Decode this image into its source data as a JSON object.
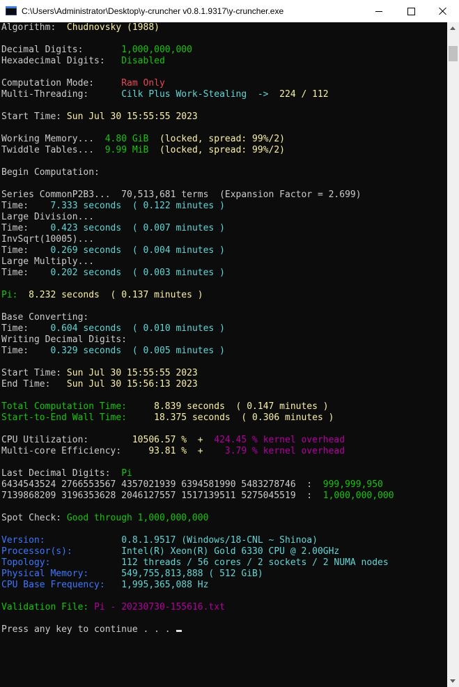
{
  "window": {
    "title": "C:\\Users\\Administrator\\Desktop\\y-cruncher v0.8.1.9317\\y-cruncher.exe"
  },
  "colors": {
    "background": "#0c0c0c",
    "white": "#cccccc",
    "yellow": "#f9f1a5",
    "green": "#16c60c",
    "red": "#e74856",
    "cyan": "#61d6d6",
    "blue": "#3b78ff",
    "magenta": "#b4009e"
  },
  "icons": [
    "console-app-icon",
    "minimize-icon",
    "maximize-icon",
    "close-icon",
    "scroll-up-arrow-icon",
    "scroll-down-arrow-icon"
  ],
  "console": {
    "lines": [
      [
        {
          "t": "Algorithm:  ",
          "c": "w"
        },
        {
          "t": "Chudnovsky (1988)",
          "c": "y"
        }
      ],
      [],
      [
        {
          "t": "Decimal Digits:       ",
          "c": "w"
        },
        {
          "t": "1,000,000,000",
          "c": "g"
        }
      ],
      [
        {
          "t": "Hexadecimal Digits:   ",
          "c": "w"
        },
        {
          "t": "Disabled",
          "c": "g"
        }
      ],
      [],
      [
        {
          "t": "Computation Mode:     ",
          "c": "w"
        },
        {
          "t": "Ram Only",
          "c": "r"
        }
      ],
      [
        {
          "t": "Multi-Threading:      ",
          "c": "w"
        },
        {
          "t": "Cilk Plus Work-Stealing  ->  ",
          "c": "c"
        },
        {
          "t": "224 / 112",
          "c": "y"
        }
      ],
      [],
      [
        {
          "t": "Start Time: ",
          "c": "w"
        },
        {
          "t": "Sun Jul 30 15:55:55 2023",
          "c": "y"
        }
      ],
      [],
      [
        {
          "t": "Working Memory...  ",
          "c": "w"
        },
        {
          "t": "4.80 GiB",
          "c": "g"
        },
        {
          "t": "  (locked, spread: 99%/2)",
          "c": "y"
        }
      ],
      [
        {
          "t": "Twiddle Tables...  ",
          "c": "w"
        },
        {
          "t": "9.99 MiB",
          "c": "g"
        },
        {
          "t": "  (locked, spread: 99%/2)",
          "c": "y"
        }
      ],
      [],
      [
        {
          "t": "Begin Computation:",
          "c": "w"
        }
      ],
      [],
      [
        {
          "t": "Series CommonP2B3...  70,513,681 terms  (Expansion Factor = 2.699)",
          "c": "w"
        }
      ],
      [
        {
          "t": "Time:    ",
          "c": "w"
        },
        {
          "t": "7.333 seconds  ( 0.122 minutes )",
          "c": "c"
        }
      ],
      [
        {
          "t": "Large Division...",
          "c": "w"
        }
      ],
      [
        {
          "t": "Time:    ",
          "c": "w"
        },
        {
          "t": "0.423 seconds  ( 0.007 minutes )",
          "c": "c"
        }
      ],
      [
        {
          "t": "InvSqrt(10005)...",
          "c": "w"
        }
      ],
      [
        {
          "t": "Time:    ",
          "c": "w"
        },
        {
          "t": "0.269 seconds  ( 0.004 minutes )",
          "c": "c"
        }
      ],
      [
        {
          "t": "Large Multiply...",
          "c": "w"
        }
      ],
      [
        {
          "t": "Time:    ",
          "c": "w"
        },
        {
          "t": "0.202 seconds  ( 0.003 minutes )",
          "c": "c"
        }
      ],
      [],
      [
        {
          "t": "Pi:  ",
          "c": "g"
        },
        {
          "t": "8.232 seconds  ( 0.137 minutes )",
          "c": "y"
        }
      ],
      [],
      [
        {
          "t": "Base Converting:",
          "c": "w"
        }
      ],
      [
        {
          "t": "Time:    ",
          "c": "w"
        },
        {
          "t": "0.604 seconds  ( 0.010 minutes )",
          "c": "c"
        }
      ],
      [
        {
          "t": "Writing Decimal Digits:",
          "c": "w"
        }
      ],
      [
        {
          "t": "Time:    ",
          "c": "w"
        },
        {
          "t": "0.329 seconds  ( 0.005 minutes )",
          "c": "c"
        }
      ],
      [],
      [
        {
          "t": "Start Time: ",
          "c": "w"
        },
        {
          "t": "Sun Jul 30 15:55:55 2023",
          "c": "y"
        }
      ],
      [
        {
          "t": "End Time:   ",
          "c": "w"
        },
        {
          "t": "Sun Jul 30 15:56:13 2023",
          "c": "y"
        }
      ],
      [],
      [
        {
          "t": "Total Computation Time:     ",
          "c": "g"
        },
        {
          "t": "8.839 seconds  ( 0.147 minutes )",
          "c": "y"
        }
      ],
      [
        {
          "t": "Start-to-End Wall Time:     ",
          "c": "g"
        },
        {
          "t": "18.375 seconds  ( 0.306 minutes )",
          "c": "y"
        }
      ],
      [],
      [
        {
          "t": "CPU Utilization:        ",
          "c": "w"
        },
        {
          "t": "10506.57 %  +  ",
          "c": "y"
        },
        {
          "t": "424.45 % kernel overhead",
          "c": "m"
        }
      ],
      [
        {
          "t": "Multi-core Efficiency:     ",
          "c": "w"
        },
        {
          "t": "93.81 %  +    ",
          "c": "y"
        },
        {
          "t": "3.79 % kernel overhead",
          "c": "m"
        }
      ],
      [],
      [
        {
          "t": "Last Decimal Digits:  ",
          "c": "w"
        },
        {
          "t": "Pi",
          "c": "g"
        }
      ],
      [
        {
          "t": "6434543524 2766553567 4357021939 6394581990 5483278746  :  ",
          "c": "w"
        },
        {
          "t": "999,999,950",
          "c": "g"
        }
      ],
      [
        {
          "t": "7139868209 3196353628 2046127557 1517139511 5275045519  :  ",
          "c": "w"
        },
        {
          "t": "1,000,000,000",
          "c": "g"
        }
      ],
      [],
      [
        {
          "t": "Spot Check: ",
          "c": "w"
        },
        {
          "t": "Good through 1,000,000,000",
          "c": "g"
        }
      ],
      [],
      [
        {
          "t": "Version:              ",
          "c": "b"
        },
        {
          "t": "0.8.1.9517 (Windows/18-CNL ~ Shinoa)",
          "c": "c"
        }
      ],
      [
        {
          "t": "Processor(s):         ",
          "c": "b"
        },
        {
          "t": "Intel(R) Xeon(R) Gold 6330 CPU @ 2.00GHz",
          "c": "c"
        }
      ],
      [
        {
          "t": "Topology:             ",
          "c": "b"
        },
        {
          "t": "112 threads / 56 cores / 2 sockets / 2 NUMA nodes",
          "c": "c"
        }
      ],
      [
        {
          "t": "Physical Memory:      ",
          "c": "b"
        },
        {
          "t": "549,755,813,888 ( 512 GiB)",
          "c": "c"
        }
      ],
      [
        {
          "t": "CPU Base Frequency:   ",
          "c": "b"
        },
        {
          "t": "1,995,365,088 Hz",
          "c": "c"
        }
      ],
      [],
      [
        {
          "t": "Validation File: ",
          "c": "g"
        },
        {
          "t": "Pi - 20230730-155616.txt",
          "c": "m"
        }
      ],
      [],
      [
        {
          "t": "Press any key to continue . . . ",
          "c": "w"
        }
      ]
    ]
  }
}
